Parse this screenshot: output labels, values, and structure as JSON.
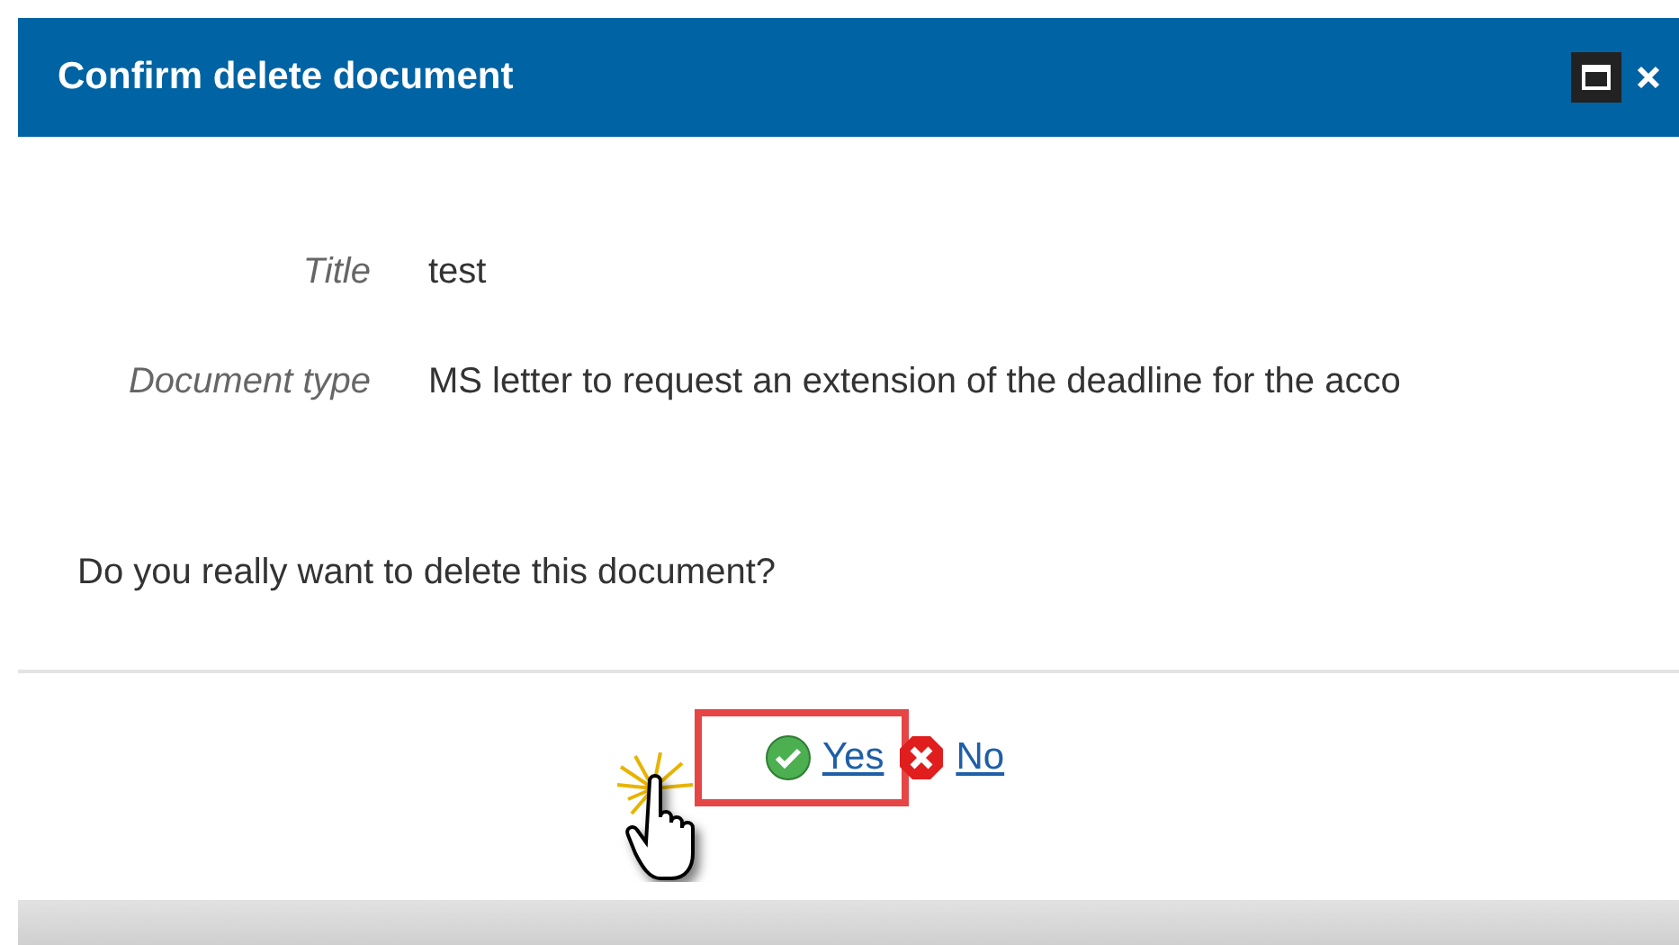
{
  "window": {
    "title": "Confirm delete document"
  },
  "fields": [
    {
      "label": "Title",
      "value": "test"
    },
    {
      "label": "Document type",
      "value": "MS letter to request an extension of the deadline for the acco"
    }
  ],
  "question": "Do you really want to delete this document?",
  "buttons": [
    {
      "kind": "confirm",
      "label": "Yes",
      "highlighted": true
    },
    {
      "kind": "cancel",
      "label": "No",
      "highlighted": false
    }
  ]
}
